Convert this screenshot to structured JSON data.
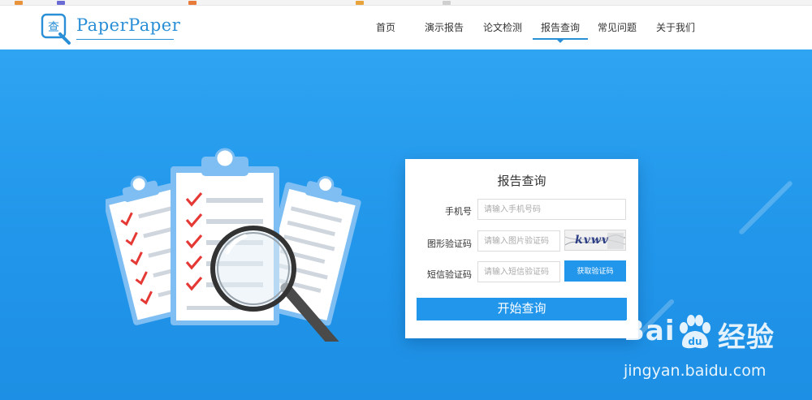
{
  "header": {
    "logo_text": "PaperPaper",
    "logo_mark_char": "查",
    "nav": [
      {
        "label": "首页",
        "active": false
      },
      {
        "label": "演示报告",
        "active": false
      },
      {
        "label": "论文检测",
        "active": false
      },
      {
        "label": "报告查询",
        "active": true
      },
      {
        "label": "常见问题",
        "active": false
      },
      {
        "label": "关于我们",
        "active": false
      }
    ]
  },
  "form": {
    "title": "报告查询",
    "phone": {
      "label": "手机号",
      "placeholder": "请输入手机号码",
      "value": ""
    },
    "captcha": {
      "label": "图形验证码",
      "placeholder": "请输入图片验证码",
      "value": "",
      "image_text": "kvwv"
    },
    "sms": {
      "label": "短信验证码",
      "placeholder": "请输入短信验证码",
      "value": "",
      "button_label": "获取验证码"
    },
    "submit_label": "开始查询"
  },
  "watermark": {
    "brand_left": "Bai",
    "brand_right": "经验",
    "url": "jingyan.baidu.com"
  },
  "colors": {
    "accent": "#2196ea",
    "hero_top": "#2ea4f2",
    "check_red": "#e53935"
  },
  "icons": [
    "search-magnifier-logo-icon",
    "clipboard-icon",
    "magnifying-glass-icon",
    "checkmark-icon",
    "baidu-paw-icon"
  ]
}
